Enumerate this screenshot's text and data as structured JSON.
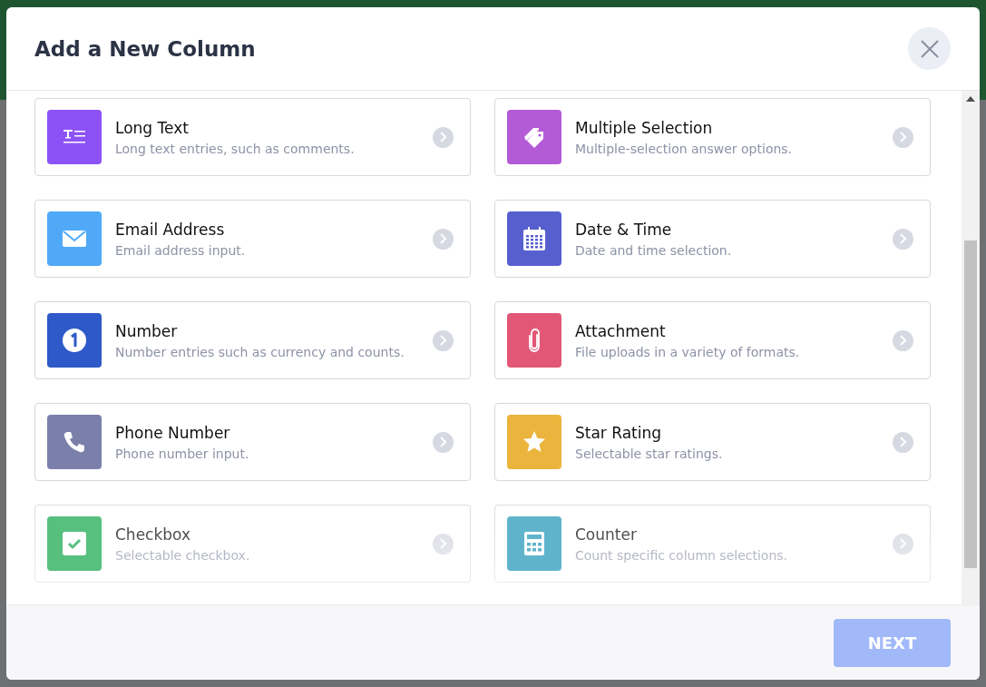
{
  "dialog": {
    "title": "Add a New Column"
  },
  "column_types": [
    {
      "kind": "long-text",
      "color": "#8c52f5",
      "name": "Long Text",
      "description": "Long text entries, such as comments."
    },
    {
      "kind": "tag",
      "color": "#b35ad6",
      "name": "Multiple Selection",
      "description": "Multiple-selection answer options."
    },
    {
      "kind": "email",
      "color": "#4fa9f7",
      "name": "Email Address",
      "description": "Email address input."
    },
    {
      "kind": "date",
      "color": "#575fcf",
      "name": "Date & Time",
      "description": "Date and time selection."
    },
    {
      "kind": "number",
      "color": "#2e59c8",
      "name": "Number",
      "description": "Number entries such as currency and counts."
    },
    {
      "kind": "attachment",
      "color": "#e25776",
      "name": "Attachment",
      "description": "File uploads in a variety of formats."
    },
    {
      "kind": "phone",
      "color": "#7b80ab",
      "name": "Phone Number",
      "description": "Phone number input."
    },
    {
      "kind": "rating",
      "color": "#ebb43c",
      "name": "Star Rating",
      "description": "Selectable star ratings."
    },
    {
      "kind": "checkbox",
      "color": "#57c07f",
      "name": "Checkbox",
      "description": "Selectable checkbox."
    },
    {
      "kind": "counter",
      "color": "#5fb4cc",
      "name": "Counter",
      "description": "Count specific column selections."
    }
  ],
  "footer": {
    "next_button": {
      "label": "NEXT",
      "disabled": true
    }
  }
}
